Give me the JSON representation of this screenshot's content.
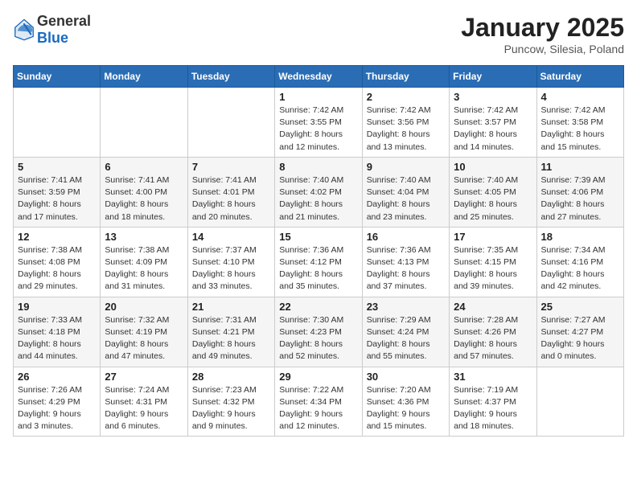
{
  "header": {
    "logo_general": "General",
    "logo_blue": "Blue",
    "title": "January 2025",
    "subtitle": "Puncow, Silesia, Poland"
  },
  "weekdays": [
    "Sunday",
    "Monday",
    "Tuesday",
    "Wednesday",
    "Thursday",
    "Friday",
    "Saturday"
  ],
  "weeks": [
    [
      {
        "day": "",
        "info": ""
      },
      {
        "day": "",
        "info": ""
      },
      {
        "day": "",
        "info": ""
      },
      {
        "day": "1",
        "info": "Sunrise: 7:42 AM\nSunset: 3:55 PM\nDaylight: 8 hours and 12 minutes."
      },
      {
        "day": "2",
        "info": "Sunrise: 7:42 AM\nSunset: 3:56 PM\nDaylight: 8 hours and 13 minutes."
      },
      {
        "day": "3",
        "info": "Sunrise: 7:42 AM\nSunset: 3:57 PM\nDaylight: 8 hours and 14 minutes."
      },
      {
        "day": "4",
        "info": "Sunrise: 7:42 AM\nSunset: 3:58 PM\nDaylight: 8 hours and 15 minutes."
      }
    ],
    [
      {
        "day": "5",
        "info": "Sunrise: 7:41 AM\nSunset: 3:59 PM\nDaylight: 8 hours and 17 minutes."
      },
      {
        "day": "6",
        "info": "Sunrise: 7:41 AM\nSunset: 4:00 PM\nDaylight: 8 hours and 18 minutes."
      },
      {
        "day": "7",
        "info": "Sunrise: 7:41 AM\nSunset: 4:01 PM\nDaylight: 8 hours and 20 minutes."
      },
      {
        "day": "8",
        "info": "Sunrise: 7:40 AM\nSunset: 4:02 PM\nDaylight: 8 hours and 21 minutes."
      },
      {
        "day": "9",
        "info": "Sunrise: 7:40 AM\nSunset: 4:04 PM\nDaylight: 8 hours and 23 minutes."
      },
      {
        "day": "10",
        "info": "Sunrise: 7:40 AM\nSunset: 4:05 PM\nDaylight: 8 hours and 25 minutes."
      },
      {
        "day": "11",
        "info": "Sunrise: 7:39 AM\nSunset: 4:06 PM\nDaylight: 8 hours and 27 minutes."
      }
    ],
    [
      {
        "day": "12",
        "info": "Sunrise: 7:38 AM\nSunset: 4:08 PM\nDaylight: 8 hours and 29 minutes."
      },
      {
        "day": "13",
        "info": "Sunrise: 7:38 AM\nSunset: 4:09 PM\nDaylight: 8 hours and 31 minutes."
      },
      {
        "day": "14",
        "info": "Sunrise: 7:37 AM\nSunset: 4:10 PM\nDaylight: 8 hours and 33 minutes."
      },
      {
        "day": "15",
        "info": "Sunrise: 7:36 AM\nSunset: 4:12 PM\nDaylight: 8 hours and 35 minutes."
      },
      {
        "day": "16",
        "info": "Sunrise: 7:36 AM\nSunset: 4:13 PM\nDaylight: 8 hours and 37 minutes."
      },
      {
        "day": "17",
        "info": "Sunrise: 7:35 AM\nSunset: 4:15 PM\nDaylight: 8 hours and 39 minutes."
      },
      {
        "day": "18",
        "info": "Sunrise: 7:34 AM\nSunset: 4:16 PM\nDaylight: 8 hours and 42 minutes."
      }
    ],
    [
      {
        "day": "19",
        "info": "Sunrise: 7:33 AM\nSunset: 4:18 PM\nDaylight: 8 hours and 44 minutes."
      },
      {
        "day": "20",
        "info": "Sunrise: 7:32 AM\nSunset: 4:19 PM\nDaylight: 8 hours and 47 minutes."
      },
      {
        "day": "21",
        "info": "Sunrise: 7:31 AM\nSunset: 4:21 PM\nDaylight: 8 hours and 49 minutes."
      },
      {
        "day": "22",
        "info": "Sunrise: 7:30 AM\nSunset: 4:23 PM\nDaylight: 8 hours and 52 minutes."
      },
      {
        "day": "23",
        "info": "Sunrise: 7:29 AM\nSunset: 4:24 PM\nDaylight: 8 hours and 55 minutes."
      },
      {
        "day": "24",
        "info": "Sunrise: 7:28 AM\nSunset: 4:26 PM\nDaylight: 8 hours and 57 minutes."
      },
      {
        "day": "25",
        "info": "Sunrise: 7:27 AM\nSunset: 4:27 PM\nDaylight: 9 hours and 0 minutes."
      }
    ],
    [
      {
        "day": "26",
        "info": "Sunrise: 7:26 AM\nSunset: 4:29 PM\nDaylight: 9 hours and 3 minutes."
      },
      {
        "day": "27",
        "info": "Sunrise: 7:24 AM\nSunset: 4:31 PM\nDaylight: 9 hours and 6 minutes."
      },
      {
        "day": "28",
        "info": "Sunrise: 7:23 AM\nSunset: 4:32 PM\nDaylight: 9 hours and 9 minutes."
      },
      {
        "day": "29",
        "info": "Sunrise: 7:22 AM\nSunset: 4:34 PM\nDaylight: 9 hours and 12 minutes."
      },
      {
        "day": "30",
        "info": "Sunrise: 7:20 AM\nSunset: 4:36 PM\nDaylight: 9 hours and 15 minutes."
      },
      {
        "day": "31",
        "info": "Sunrise: 7:19 AM\nSunset: 4:37 PM\nDaylight: 9 hours and 18 minutes."
      },
      {
        "day": "",
        "info": ""
      }
    ]
  ]
}
